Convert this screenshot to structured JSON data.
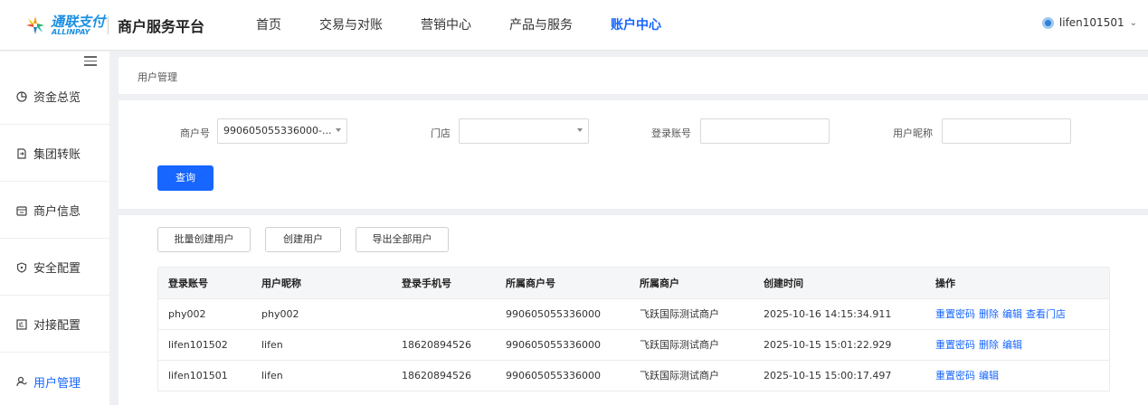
{
  "header": {
    "logo_cn": "通联支付",
    "logo_en": "ALLINPAY",
    "platform_title": "商户服务平台",
    "nav": [
      {
        "label": "首页",
        "active": false
      },
      {
        "label": "交易与对账",
        "active": false
      },
      {
        "label": "营销中心",
        "active": false
      },
      {
        "label": "产品与服务",
        "active": false
      },
      {
        "label": "账户中心",
        "active": true
      }
    ],
    "username": "lifen101501"
  },
  "sidebar": {
    "items": [
      {
        "label": "资金总览",
        "icon": "pie-chart-icon",
        "active": false
      },
      {
        "label": "集团转账",
        "icon": "document-transfer-icon",
        "active": false
      },
      {
        "label": "商户信息",
        "icon": "store-icon",
        "active": false
      },
      {
        "label": "安全配置",
        "icon": "shield-icon",
        "active": false
      },
      {
        "label": "对接配置",
        "icon": "plug-icon",
        "active": false
      },
      {
        "label": "用户管理",
        "icon": "user-icon",
        "active": true
      }
    ]
  },
  "breadcrumb": "用户管理",
  "filters": {
    "merchant_label": "商户号",
    "merchant_value": "990605055336000-...",
    "store_label": "门店",
    "store_value": "",
    "login_label": "登录账号",
    "login_value": "",
    "nickname_label": "用户昵称",
    "nickname_value": "",
    "query_label": "查询"
  },
  "actions": {
    "batch_create": "批量创建用户",
    "create": "创建用户",
    "export_all": "导出全部用户"
  },
  "table": {
    "headers": [
      "登录账号",
      "用户昵称",
      "登录手机号",
      "所属商户号",
      "所属商户",
      "创建时间",
      "操作"
    ],
    "rows": [
      {
        "login": "phy002",
        "nickname": "phy002",
        "phone": "",
        "merchant_no": "990605055336000",
        "merchant": "飞跃国际测试商户",
        "created": "2025-10-16 14:15:34.911",
        "ops": [
          "重置密码",
          "删除",
          "编辑",
          "查看门店"
        ]
      },
      {
        "login": "lifen101502",
        "nickname": "lifen",
        "phone": "18620894526",
        "merchant_no": "990605055336000",
        "merchant": "飞跃国际测试商户",
        "created": "2025-10-15 15:01:22.929",
        "ops": [
          "重置密码",
          "删除",
          "编辑"
        ]
      },
      {
        "login": "lifen101501",
        "nickname": "lifen",
        "phone": "18620894526",
        "merchant_no": "990605055336000",
        "merchant": "飞跃国际测试商户",
        "created": "2025-10-15 15:00:17.497",
        "ops": [
          "重置密码",
          "编辑"
        ]
      }
    ]
  },
  "colors": {
    "primary": "#1666ff",
    "background": "#eef0f3",
    "table_header": "#f5f6f8"
  }
}
